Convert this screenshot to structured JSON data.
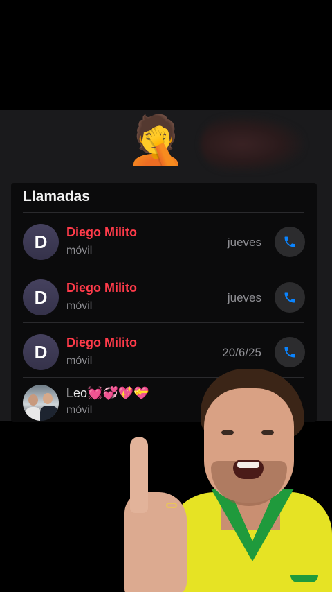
{
  "overlay": {
    "emoji": "🤦"
  },
  "calls": {
    "title": "Llamadas",
    "rows": [
      {
        "initial": "D",
        "name": "Diego Milito",
        "type": "móvil",
        "when": "jueves"
      },
      {
        "initial": "D",
        "name": "Diego Milito",
        "type": "móvil",
        "when": "jueves"
      },
      {
        "initial": "D",
        "name": "Diego Milito",
        "type": "móvil",
        "when": "20/6/25"
      }
    ],
    "last_row": {
      "name": "Leo💓💞💖💝",
      "type": "móvil"
    }
  },
  "icons": {
    "call": "phone-icon"
  },
  "colors": {
    "missed_call_red": "#ff3b4a",
    "call_icon_blue": "#0a84ff",
    "card_bg": "#0b0b0c"
  }
}
